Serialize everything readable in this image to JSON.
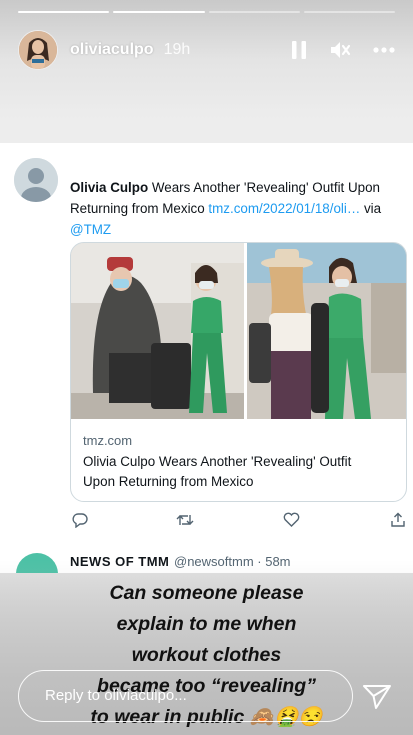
{
  "story": {
    "username": "oliviaculpo",
    "time_ago": "19h",
    "progress_segments": [
      1,
      1,
      0,
      0
    ],
    "pause_icon": "pause-icon",
    "mute_icon": "speaker-muted-icon",
    "more_icon": "more-dots-icon"
  },
  "tweet": {
    "author": "Olivia Culpo",
    "text_main": " Wears Another 'Revealing' Outfit Upon Returning from Mexico ",
    "link": "tmz.com/2022/01/18/oli…",
    "via": " via",
    "mention": "@TMZ",
    "card": {
      "domain": "tmz.com",
      "title": "Olivia Culpo Wears Another 'Revealing' Outfit Upon Returning from Mexico"
    },
    "actions": [
      "reply-icon",
      "retweet-icon",
      "like-icon",
      "share-icon"
    ]
  },
  "next_tweet": {
    "name": "NEWS OF TMM",
    "handle": "@newsoftmm · 58m"
  },
  "caption": {
    "lines": [
      "Can someone please",
      "explain to me when",
      "workout clothes",
      "became too “revealing”",
      "to wear in public 🙈🤮😒"
    ]
  },
  "reply": {
    "placeholder": "Reply to oliviaculpo...",
    "send_icon": "send-icon"
  }
}
